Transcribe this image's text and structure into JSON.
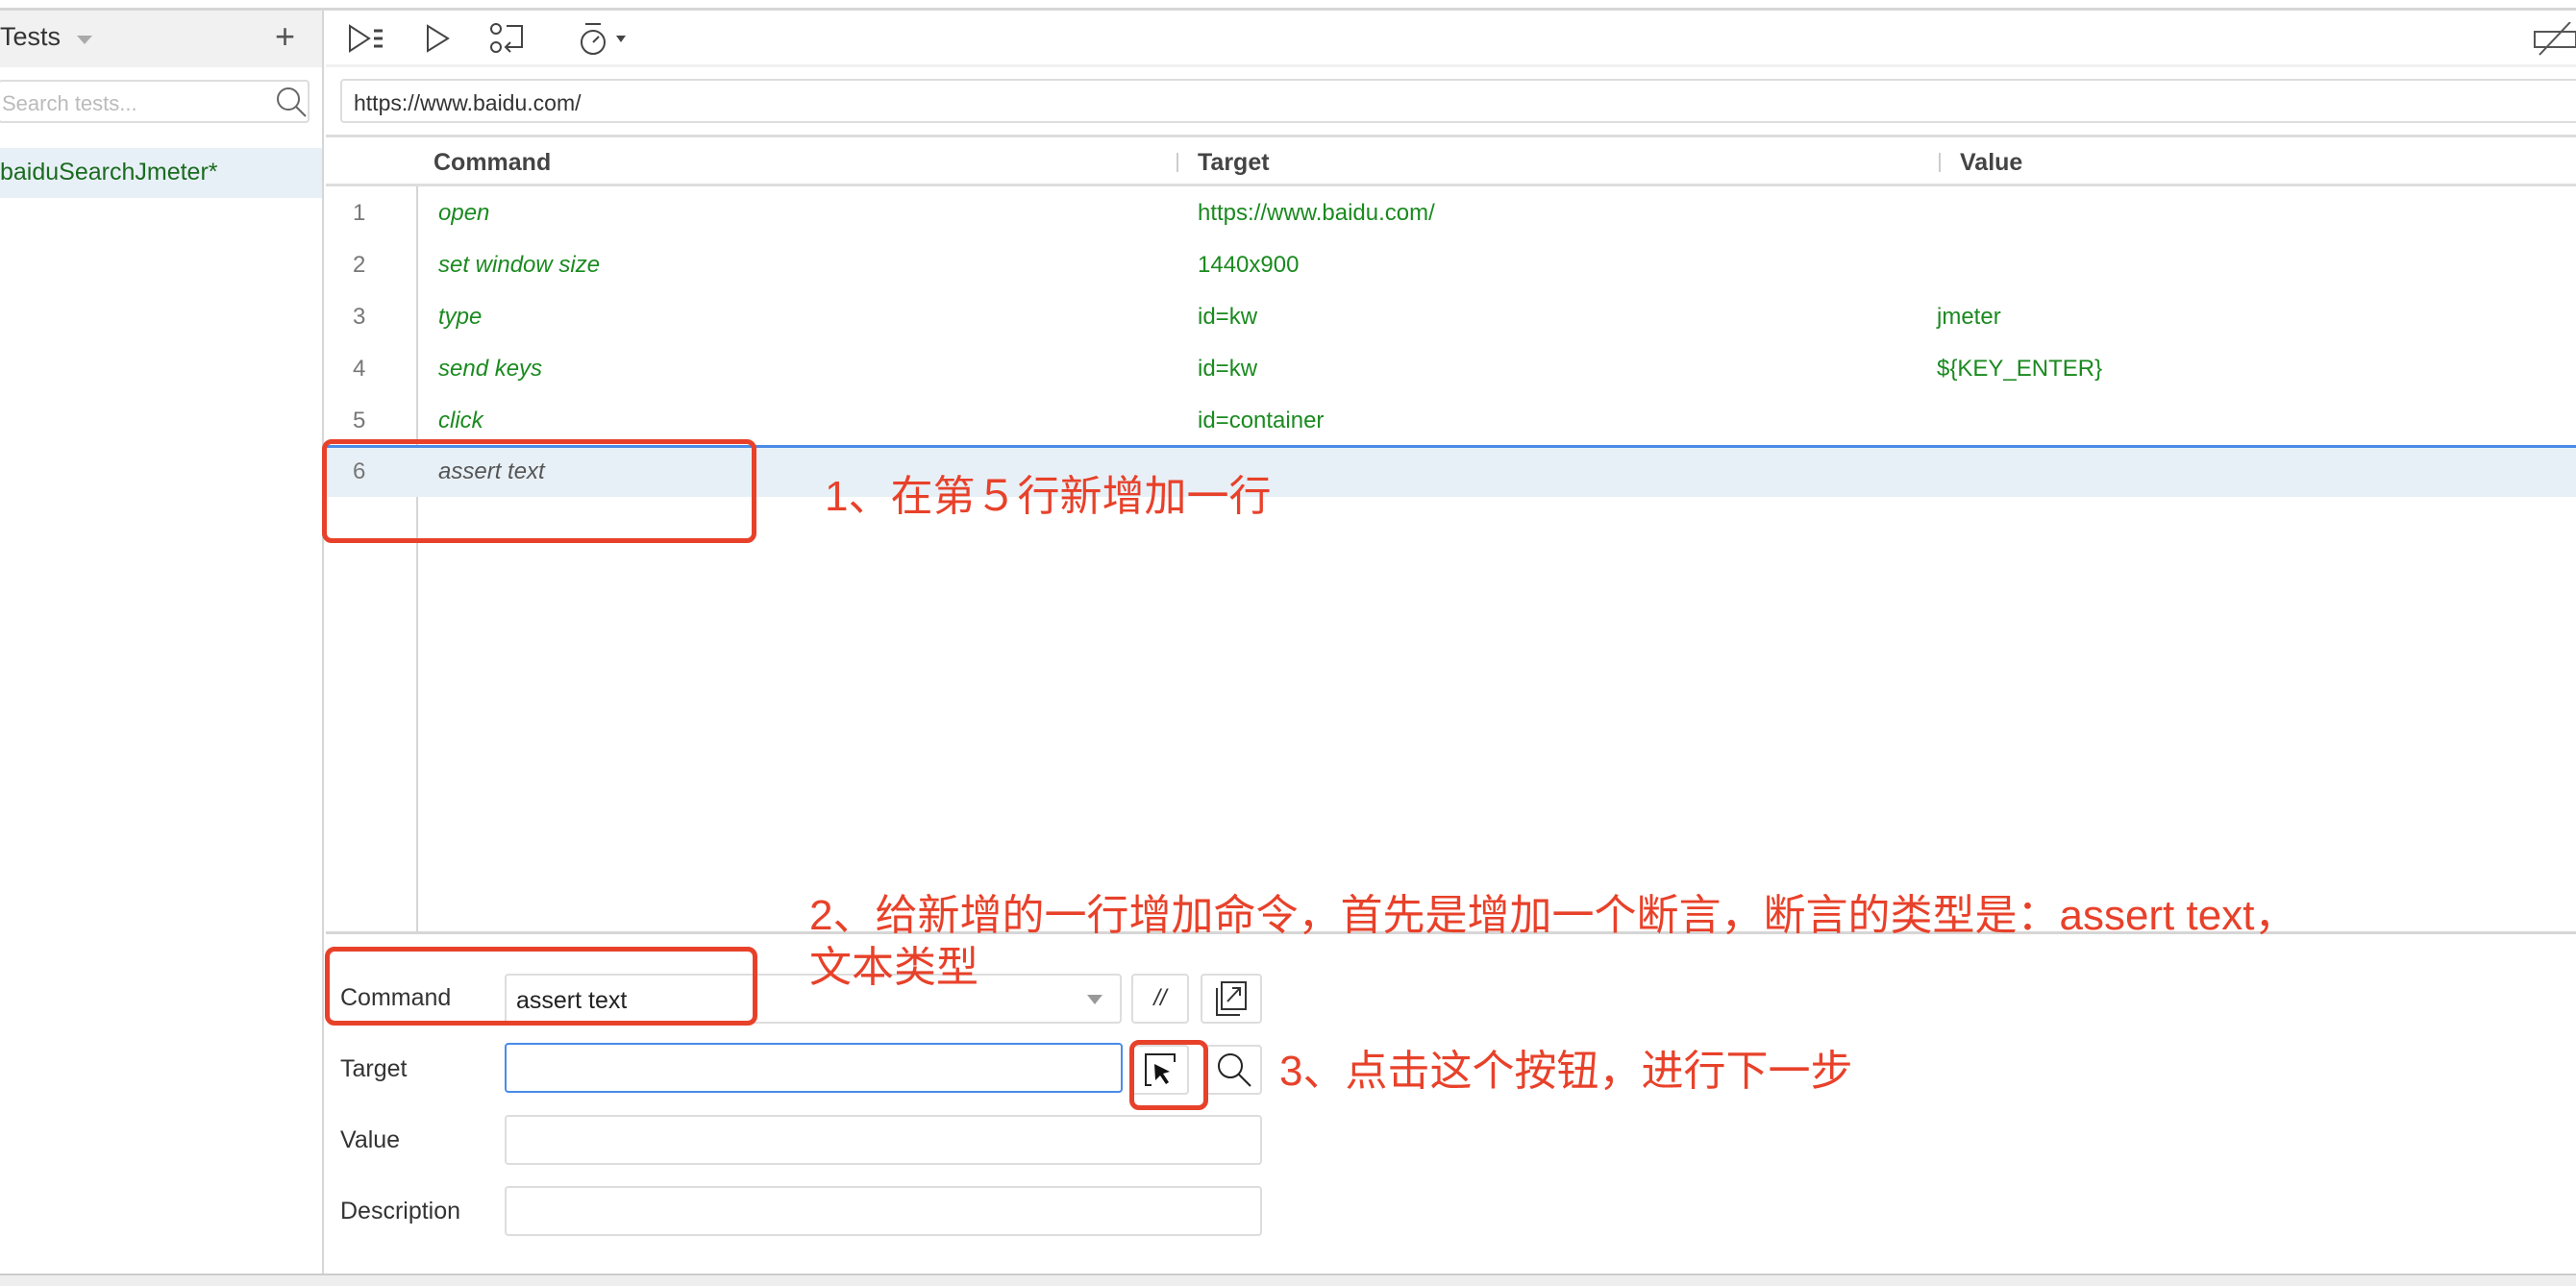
{
  "sidebar": {
    "title": "Tests",
    "add_label": "+",
    "search_placeholder": "Search tests...",
    "tests": [
      {
        "name": "baiduSearchJmeter*"
      }
    ]
  },
  "toolbar": {
    "icons": [
      "run-all-icon",
      "run-icon",
      "step-icon",
      "speed-icon",
      "disable-breakpoints-icon"
    ]
  },
  "url": "https://www.baidu.com/",
  "table": {
    "headers": [
      "Command",
      "Target",
      "Value"
    ],
    "rows": [
      {
        "n": "1",
        "command": "open",
        "target": "https://www.baidu.com/",
        "value": ""
      },
      {
        "n": "2",
        "command": "set window size",
        "target": "1440x900",
        "value": ""
      },
      {
        "n": "3",
        "command": "type",
        "target": "id=kw",
        "value": "jmeter"
      },
      {
        "n": "4",
        "command": "send keys",
        "target": "id=kw",
        "value": "${KEY_ENTER}"
      },
      {
        "n": "5",
        "command": "click",
        "target": "id=container",
        "value": ""
      },
      {
        "n": "6",
        "command": "assert text",
        "target": "",
        "value": ""
      }
    ]
  },
  "editor": {
    "command_label": "Command",
    "command_value": "assert text",
    "comment_label": "//",
    "target_label": "Target",
    "target_value": "",
    "value_label": "Value",
    "value_value": "",
    "description_label": "Description",
    "description_value": ""
  },
  "annotations": {
    "note1": "1、在第５行新增加一行",
    "note2_line1": "2、给新增的一行增加命令，首先是增加一个断言，断言的类型是：assert text，",
    "note2_line2": "文本类型",
    "note3": "3、点击这个按钮，进行下一步"
  },
  "colors": {
    "annotation": "#e8412a",
    "command_text": "#1a8a1f",
    "selection": "#e8f0f7",
    "focus": "#4a8be8"
  }
}
